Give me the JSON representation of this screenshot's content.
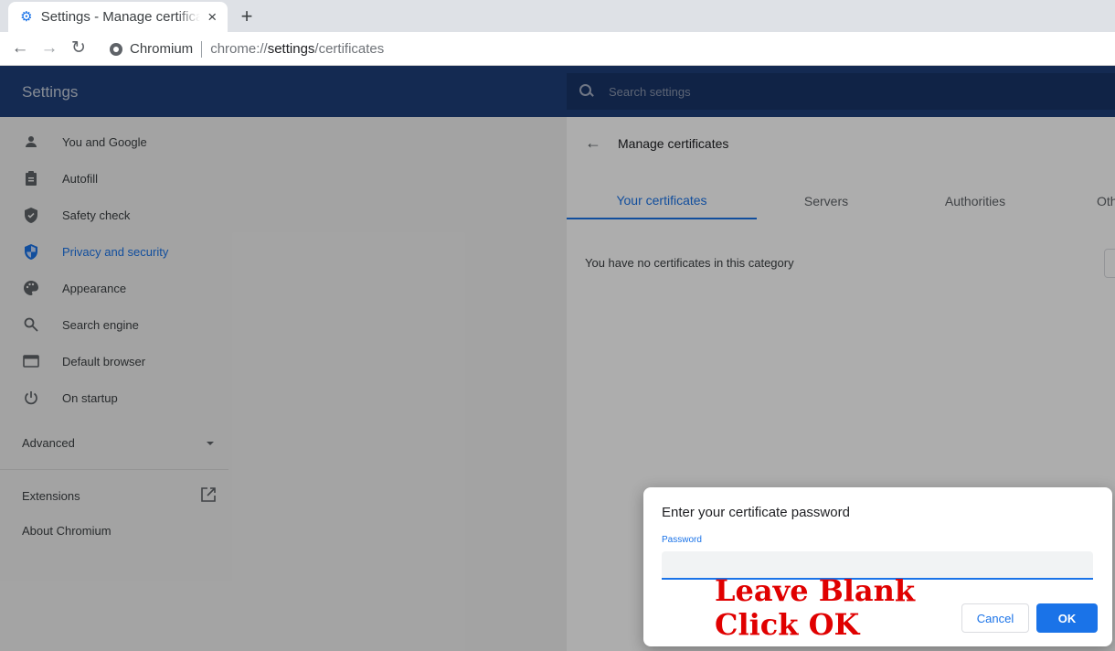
{
  "browser": {
    "tab_title": "Settings - Manage certificates",
    "tab_close_glyph": "×",
    "new_tab_glyph": "+",
    "site_name": "Chromium",
    "url_scheme": "chrome://",
    "url_host": "settings",
    "url_path": "/certificates"
  },
  "settings": {
    "title": "Settings",
    "search_placeholder": "Search settings",
    "nav_items": [
      {
        "label": "You and Google",
        "icon": "person-icon"
      },
      {
        "label": "Autofill",
        "icon": "clipboard-icon"
      },
      {
        "label": "Safety check",
        "icon": "shield-check-icon"
      },
      {
        "label": "Privacy and security",
        "icon": "shield-icon",
        "active": true
      },
      {
        "label": "Appearance",
        "icon": "palette-icon"
      },
      {
        "label": "Search engine",
        "icon": "search-icon"
      },
      {
        "label": "Default browser",
        "icon": "browser-window-icon"
      },
      {
        "label": "On startup",
        "icon": "power-icon"
      }
    ],
    "advanced_label": "Advanced",
    "extensions_label": "Extensions",
    "about_label": "About Chromium"
  },
  "manage_certs": {
    "title": "Manage certificates",
    "tabs": [
      "Your certificates",
      "Servers",
      "Authorities",
      "Others"
    ],
    "active_tab": "Your certificates",
    "empty_message": "You have no certificates in this category"
  },
  "dialog": {
    "title": "Enter your certificate password",
    "password_label": "Password",
    "password_value": "",
    "cancel_label": "Cancel",
    "ok_label": "OK"
  },
  "annotation": {
    "line1": "Leave Blank",
    "line2": "Click OK",
    "color": "#e00000"
  },
  "colors": {
    "header_bg": "#1e3f7a",
    "accent": "#1a73e8"
  }
}
